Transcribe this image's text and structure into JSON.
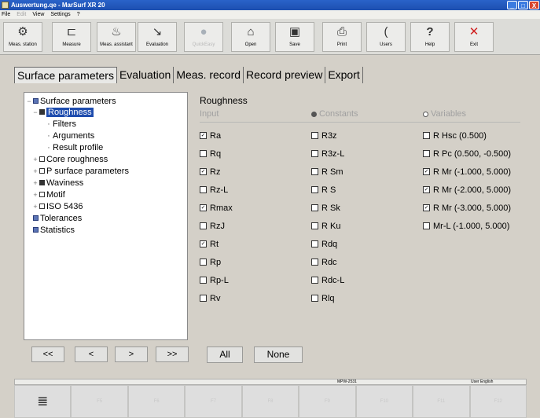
{
  "window": {
    "title": "Auswertung.qe - MarSurf XR 20",
    "buttons": [
      "_",
      "□",
      "X"
    ]
  },
  "menu": [
    "File",
    "Edit",
    "View",
    "Settings",
    "?"
  ],
  "toolbar": [
    {
      "label": "Meas. station",
      "icon": "meas-station-icon"
    },
    {
      "label": "Measure",
      "icon": "measure-icon"
    },
    {
      "label": "Meas. assistant",
      "icon": "assistant-icon"
    },
    {
      "label": "Evaluation",
      "icon": "evaluation-icon"
    },
    {
      "label": "QuickEasy",
      "icon": "quickeasy-icon",
      "disabled": true
    },
    {
      "label": "Open",
      "icon": "open-folder-icon"
    },
    {
      "label": "Save",
      "icon": "save-icon"
    },
    {
      "label": "Print",
      "icon": "printer-icon"
    },
    {
      "label": "Users",
      "icon": "users-icon"
    },
    {
      "label": "Help",
      "icon": "help-icon"
    },
    {
      "label": "Exit",
      "icon": "exit-icon"
    }
  ],
  "tabs": [
    "Surface parameters",
    "Evaluation",
    "Meas. record",
    "Record preview",
    "Export"
  ],
  "tree": [
    {
      "label": "Surface parameters"
    },
    {
      "label": "Roughness"
    },
    {
      "label": "Filters"
    },
    {
      "label": "Arguments"
    },
    {
      "label": "Result profile"
    },
    {
      "label": "Core roughness"
    },
    {
      "label": "P surface parameters"
    },
    {
      "label": "Waviness"
    },
    {
      "label": "Motif"
    },
    {
      "label": "ISO 5436"
    },
    {
      "label": "Tolerances"
    },
    {
      "label": "Statistics"
    }
  ],
  "nav": [
    "<<",
    "<",
    ">",
    ">>"
  ],
  "panel": {
    "title": "Roughness",
    "col_input": "Input",
    "col_constants": "Constants",
    "col_variables": "Variables"
  },
  "inputs": [
    {
      "label": "Ra",
      "checked": true
    },
    {
      "label": "Rq",
      "checked": false
    },
    {
      "label": "Rz",
      "checked": true
    },
    {
      "label": "Rz-L",
      "checked": false
    },
    {
      "label": "Rmax",
      "checked": true
    },
    {
      "label": "RzJ",
      "checked": false
    },
    {
      "label": "Rt",
      "checked": true
    },
    {
      "label": "Rp",
      "checked": false
    },
    {
      "label": "Rp-L",
      "checked": false
    },
    {
      "label": "Rv",
      "checked": false
    }
  ],
  "constants": [
    {
      "label": "R3z",
      "checked": false
    },
    {
      "label": "R3z-L",
      "checked": false
    },
    {
      "label": "R Sm",
      "checked": false
    },
    {
      "label": "R S",
      "checked": false
    },
    {
      "label": "R Sk",
      "checked": false
    },
    {
      "label": "R Ku",
      "checked": false
    },
    {
      "label": "Rdq",
      "checked": false
    },
    {
      "label": "Rdc",
      "checked": false
    },
    {
      "label": "Rdc-L",
      "checked": false
    },
    {
      "label": "Rlq",
      "checked": false
    }
  ],
  "variables": [
    {
      "label": "R Hsc (0.500)",
      "checked": false
    },
    {
      "label": "R Pc (0.500, -0.500)",
      "checked": false
    },
    {
      "label": "R Mr (-1.000, 5.000)",
      "checked": true
    },
    {
      "label": "R Mr (-2.000, 5.000)",
      "checked": true
    },
    {
      "label": "R Mr (-3.000, 5.000)",
      "checked": true
    },
    {
      "label": "Mr-L (-1.000, 5.000)",
      "checked": false
    }
  ],
  "buttons": {
    "all": "All",
    "none": "None"
  },
  "status": {
    "device": "MPW-2531",
    "user": "User English"
  },
  "fkeys": [
    "F5",
    "F6",
    "F7",
    "F8",
    "F9",
    "F10",
    "F11",
    "F12"
  ]
}
